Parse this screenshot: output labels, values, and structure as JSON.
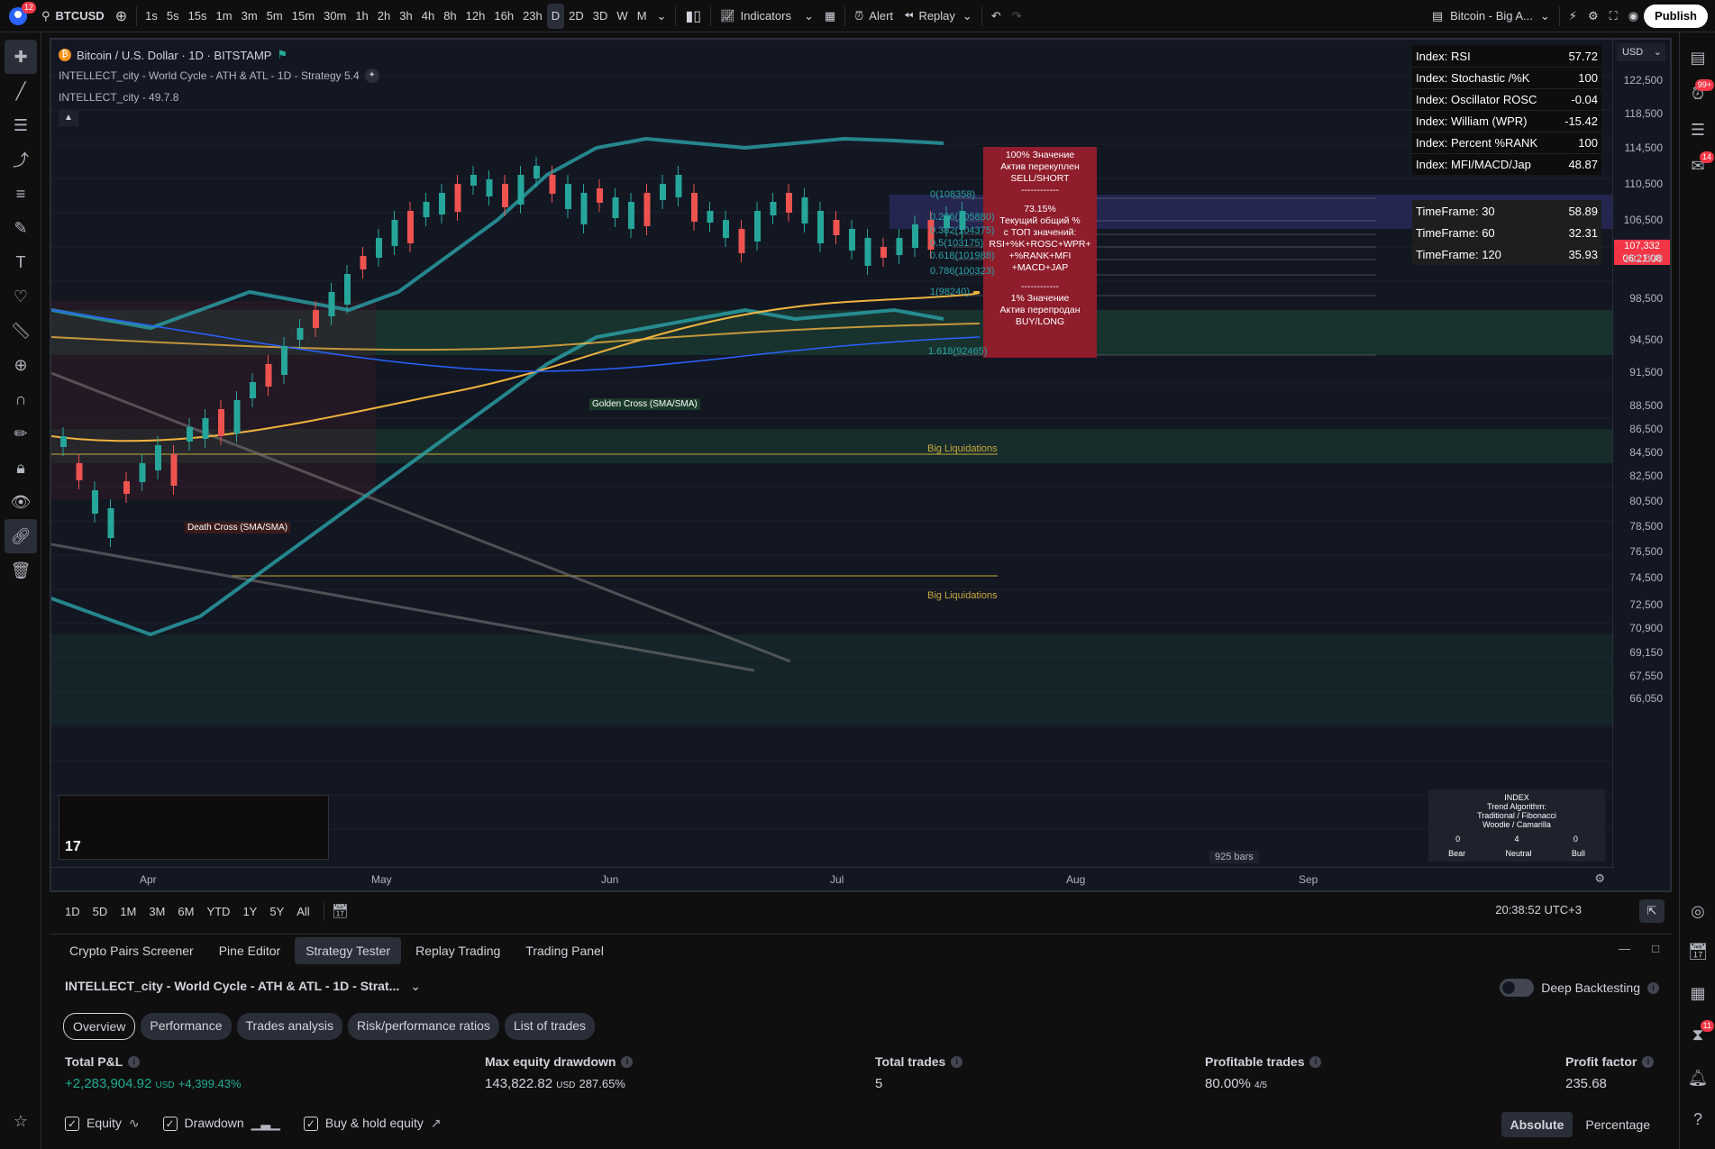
{
  "topbar": {
    "profile_badge": "12",
    "symbol": "BTCUSD",
    "timeframes": [
      "1s",
      "5s",
      "15s",
      "1m",
      "3m",
      "5m",
      "15m",
      "30m",
      "1h",
      "2h",
      "3h",
      "4h",
      "8h",
      "12h",
      "16h",
      "23h",
      "D",
      "2D",
      "3D",
      "W",
      "M"
    ],
    "active_timeframe": "D",
    "indicators_label": "Indicators",
    "alert_label": "Alert",
    "replay_label": "Replay",
    "layout_name": "Bitcoin - Big A...",
    "publish_label": "Publish"
  },
  "chart": {
    "title": "Bitcoin / U.S. Dollar · 1D · BITSTAMP",
    "strategy_legend": "INTELLECT_city - World Cycle - ATH & ATL - 1D - Strategy 5.4",
    "indicator_legend": "INTELLECT_city - 49.7.8",
    "currency": "USD",
    "price_ticks": [
      "122,500",
      "118,500",
      "114,500",
      "110,500",
      "106,500",
      "102,500",
      "98,500",
      "94,500",
      "91,500",
      "88,500",
      "86,500",
      "84,500",
      "82,500",
      "80,500",
      "78,500",
      "76,500",
      "74,500",
      "72,500",
      "70,900",
      "69,150",
      "67,550",
      "66,050"
    ],
    "current_price": "107,332",
    "countdown": "06:21:08",
    "time_labels": [
      "Apr",
      "May",
      "Jun",
      "Jul",
      "Aug",
      "Sep"
    ],
    "bars_count": "925 bars",
    "golden_cross": "Golden Cross (SMA/SMA)",
    "death_cross": "Death Cross (SMA/SMA)",
    "big_liq_1": "Big Liquidations",
    "big_liq_2": "Big Liquidations",
    "fib_levels": [
      "0(108358)",
      "0.236(105880)",
      "0.382(104375)",
      "0.5(103175)",
      "0.618(101988)",
      "0.786(100323)",
      "1(98240)",
      "1.618(92465)"
    ]
  },
  "index_table": [
    {
      "name": "Index: RSI",
      "value": "57.72"
    },
    {
      "name": "Index: Stochastic /%K",
      "value": "100"
    },
    {
      "name": "Index: Oscillator ROSC",
      "value": "-0.04"
    },
    {
      "name": "Index: William (WPR)",
      "value": "-15.42"
    },
    {
      "name": "Index: Percent %RANK",
      "value": "100"
    },
    {
      "name": "Index: MFI/MACD/Jap",
      "value": "48.87"
    }
  ],
  "tf_table": [
    {
      "name": "TimeFrame: 30",
      "value": "58.89"
    },
    {
      "name": "TimeFrame: 60",
      "value": "32.31"
    },
    {
      "name": "TimeFrame: 120",
      "value": "35.93"
    }
  ],
  "red_box": {
    "line1": "100% Значение",
    "line2": "Актив перекуплен",
    "line3": "SELL/SHORT",
    "line4": "------------",
    "line5": "73.15%",
    "line6": "Текущий общий %",
    "line7": "с ТОП значений:",
    "line8": "RSI+%K+ROSC+WPR+",
    "line9": "+%RANK+MFI",
    "line10": "+MACD+JAP",
    "line11": "------------",
    "line12": "1% Значение",
    "line13": "Актив перепродан",
    "line14": "BUY/LONG"
  },
  "algo_table": {
    "title": "INDEX",
    "subtitle": "Trend Algorithm:",
    "subtitle2": "Traditional / Fibonacci",
    "subtitle3": "Woodie / Camarilla",
    "counts": [
      "0",
      "4",
      "0"
    ],
    "labels": [
      "Bear",
      "Neutral",
      "Bull"
    ]
  },
  "bottom_toolbar": {
    "ranges": [
      "1D",
      "5D",
      "1M",
      "3M",
      "6M",
      "YTD",
      "1Y",
      "5Y",
      "All"
    ],
    "clock": "20:38:52 UTC+3"
  },
  "panel_tabs": [
    "Crypto Pairs Screener",
    "Pine Editor",
    "Strategy Tester",
    "Replay Trading",
    "Trading Panel"
  ],
  "active_panel_tab": "Strategy Tester",
  "strategy": {
    "name": "INTELLECT_city - World Cycle - ATH & ATL - 1D - Strat...",
    "deep_backtesting": "Deep Backtesting",
    "sub_tabs": [
      "Overview",
      "Performance",
      "Trades analysis",
      "Risk/performance ratios",
      "List of trades"
    ],
    "active_sub_tab": "Overview",
    "metrics": {
      "total_pnl_label": "Total P&L",
      "total_pnl_value": "+2,283,904.92",
      "total_pnl_unit": "USD",
      "total_pnl_pct": "+4,399.43%",
      "max_dd_label": "Max equity drawdown",
      "max_dd_value": "143,822.82",
      "max_dd_unit": "USD",
      "max_dd_pct": "287.65%",
      "total_trades_label": "Total trades",
      "total_trades_value": "5",
      "profitable_label": "Profitable trades",
      "profitable_value": "80.00%",
      "profitable_ratio": "4/5",
      "profit_factor_label": "Profit factor",
      "profit_factor_value": "235.68"
    },
    "legend": {
      "equity": "Equity",
      "drawdown": "Drawdown",
      "buy_hold": "Buy & hold equity"
    },
    "mode_absolute": "Absolute",
    "mode_percentage": "Percentage"
  },
  "right_toolbar_badges": {
    "alerts": "99+",
    "chat": "14",
    "apps": "11"
  },
  "colors": {
    "bull": "#26a69a",
    "bear": "#ef5350",
    "accent": "#2962ff",
    "fib": "#2aa3a8",
    "liq": "#c9a93b"
  }
}
